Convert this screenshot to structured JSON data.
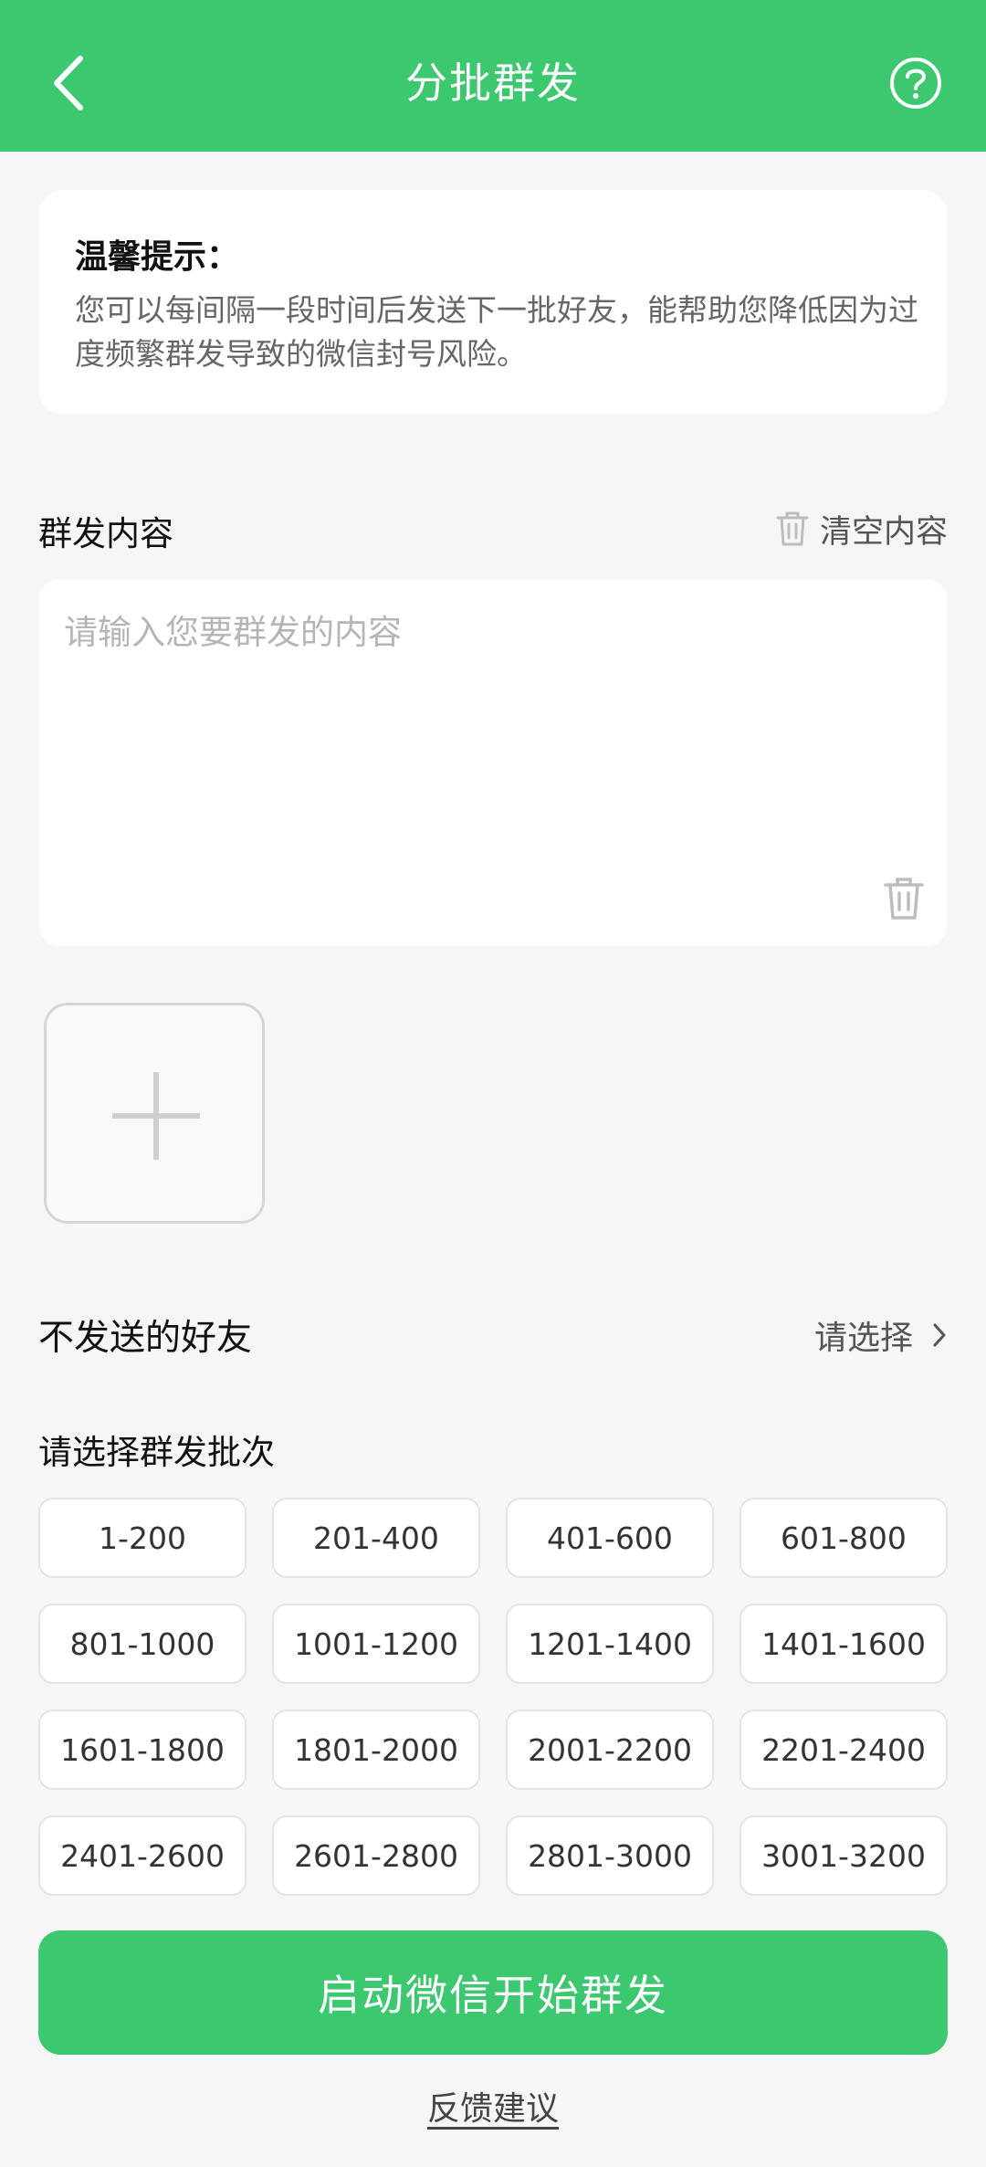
{
  "header": {
    "title": "分批群发",
    "back_icon": "chevron-left-icon",
    "help_icon": "question-circle-icon",
    "bg_color": "#3cc86e"
  },
  "tip": {
    "title": "温馨提示：",
    "body": "您可以每间隔一段时间后发送下一批好友，能帮助您降低因为过度频繁群发导致的微信封号风险。"
  },
  "content": {
    "label": "群发内容",
    "clear_label": "清空内容",
    "placeholder": "请输入您要群发的内容",
    "value": ""
  },
  "exclude": {
    "label": "不发送的好友",
    "value": "请选择"
  },
  "batches": {
    "label": "请选择群发批次",
    "items": [
      "1-200",
      "201-400",
      "401-600",
      "601-800",
      "801-1000",
      "1001-1200",
      "1201-1400",
      "1401-1600",
      "1601-1800",
      "1801-2000",
      "2001-2200",
      "2201-2400",
      "2401-2600",
      "2601-2800",
      "2801-3000",
      "3001-3200"
    ]
  },
  "actions": {
    "start_label": "启动微信开始群发",
    "feedback_label": "反馈建议"
  }
}
